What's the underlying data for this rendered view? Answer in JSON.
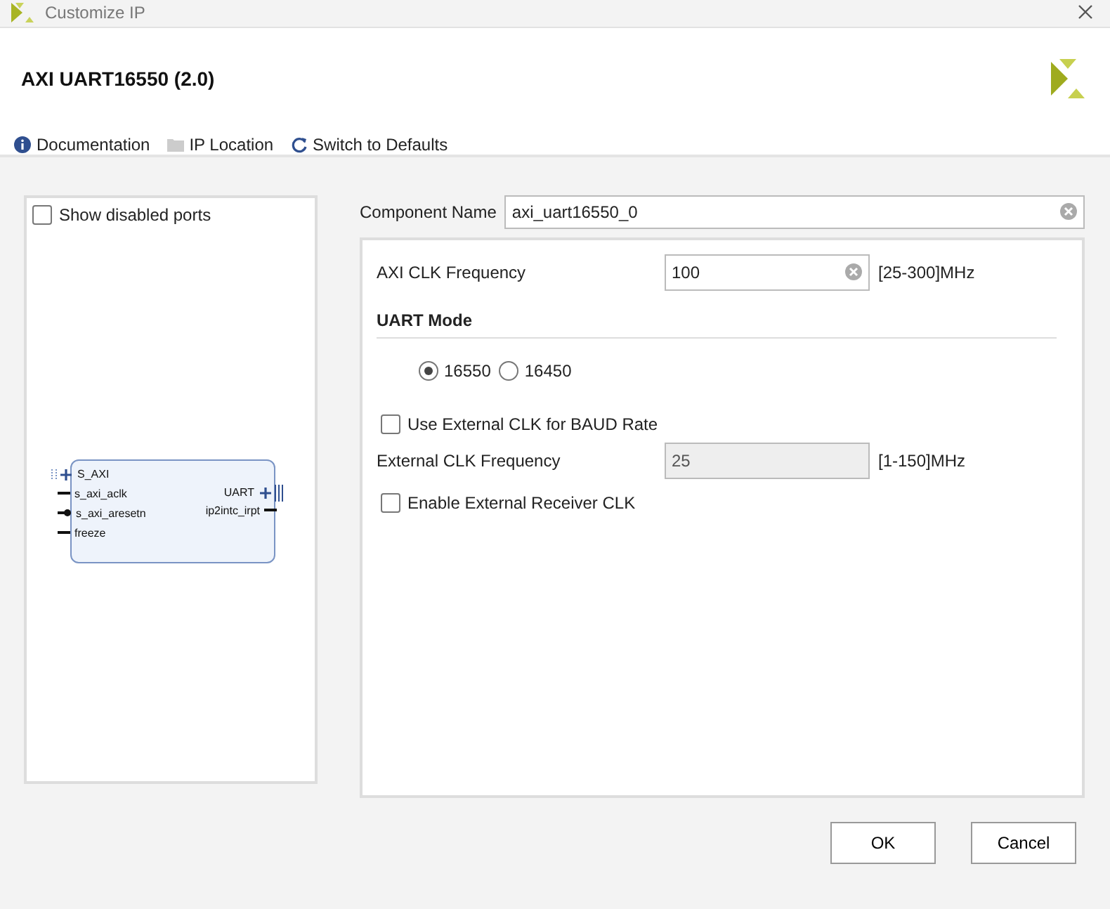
{
  "window": {
    "title": "Customize IP"
  },
  "ip_title": "AXI UART16550 (2.0)",
  "toolbar": [
    {
      "label": "Documentation",
      "kind": "info"
    },
    {
      "label": "IP Location",
      "kind": "folder"
    },
    {
      "label": "Switch to Defaults",
      "kind": "refresh"
    }
  ],
  "symbol_panel": {
    "show_disabled_ports": {
      "label": "Show disabled ports",
      "checked": false
    },
    "left_ports": [
      {
        "name": "S_AXI",
        "kind": "bus"
      },
      {
        "name": "s_axi_aclk",
        "kind": "signal"
      },
      {
        "name": "s_axi_aresetn",
        "kind": "reset"
      },
      {
        "name": "freeze",
        "kind": "signal"
      }
    ],
    "right_ports": [
      {
        "name": "UART",
        "kind": "bus"
      },
      {
        "name": "ip2intc_irpt",
        "kind": "signal"
      }
    ]
  },
  "component_name": {
    "label": "Component Name",
    "value": "axi_uart16550_0"
  },
  "params": [
    {
      "kind": "field",
      "label": "AXI CLK Frequency",
      "value": "100",
      "range": "[25-300]MHz",
      "disabled": false
    },
    {
      "kind": "section",
      "label": "UART Mode"
    },
    {
      "kind": "radio",
      "options": [
        {
          "label": "16550",
          "selected": true
        },
        {
          "label": "16450",
          "selected": false
        }
      ]
    },
    {
      "kind": "checkbox",
      "label": "Use External CLK for BAUD Rate",
      "checked": false
    },
    {
      "kind": "field",
      "label": "External CLK Frequency",
      "value": "25",
      "range": "[1-150]MHz",
      "disabled": true
    },
    {
      "kind": "checkbox",
      "label": "Enable External Receiver CLK",
      "checked": false
    }
  ],
  "buttons": [
    "OK",
    "Cancel"
  ]
}
